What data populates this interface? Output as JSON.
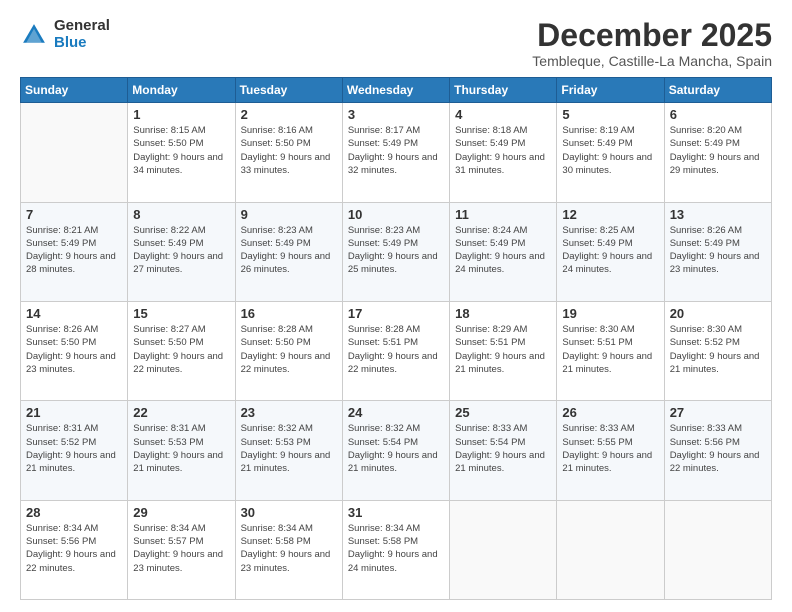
{
  "logo": {
    "general": "General",
    "blue": "Blue"
  },
  "title": "December 2025",
  "location": "Tembleque, Castille-La Mancha, Spain",
  "days_of_week": [
    "Sunday",
    "Monday",
    "Tuesday",
    "Wednesday",
    "Thursday",
    "Friday",
    "Saturday"
  ],
  "weeks": [
    [
      {
        "day": "",
        "sunrise": "",
        "sunset": "",
        "daylight": ""
      },
      {
        "day": "1",
        "sunrise": "Sunrise: 8:15 AM",
        "sunset": "Sunset: 5:50 PM",
        "daylight": "Daylight: 9 hours and 34 minutes."
      },
      {
        "day": "2",
        "sunrise": "Sunrise: 8:16 AM",
        "sunset": "Sunset: 5:50 PM",
        "daylight": "Daylight: 9 hours and 33 minutes."
      },
      {
        "day": "3",
        "sunrise": "Sunrise: 8:17 AM",
        "sunset": "Sunset: 5:49 PM",
        "daylight": "Daylight: 9 hours and 32 minutes."
      },
      {
        "day": "4",
        "sunrise": "Sunrise: 8:18 AM",
        "sunset": "Sunset: 5:49 PM",
        "daylight": "Daylight: 9 hours and 31 minutes."
      },
      {
        "day": "5",
        "sunrise": "Sunrise: 8:19 AM",
        "sunset": "Sunset: 5:49 PM",
        "daylight": "Daylight: 9 hours and 30 minutes."
      },
      {
        "day": "6",
        "sunrise": "Sunrise: 8:20 AM",
        "sunset": "Sunset: 5:49 PM",
        "daylight": "Daylight: 9 hours and 29 minutes."
      }
    ],
    [
      {
        "day": "7",
        "sunrise": "Sunrise: 8:21 AM",
        "sunset": "Sunset: 5:49 PM",
        "daylight": "Daylight: 9 hours and 28 minutes."
      },
      {
        "day": "8",
        "sunrise": "Sunrise: 8:22 AM",
        "sunset": "Sunset: 5:49 PM",
        "daylight": "Daylight: 9 hours and 27 minutes."
      },
      {
        "day": "9",
        "sunrise": "Sunrise: 8:23 AM",
        "sunset": "Sunset: 5:49 PM",
        "daylight": "Daylight: 9 hours and 26 minutes."
      },
      {
        "day": "10",
        "sunrise": "Sunrise: 8:23 AM",
        "sunset": "Sunset: 5:49 PM",
        "daylight": "Daylight: 9 hours and 25 minutes."
      },
      {
        "day": "11",
        "sunrise": "Sunrise: 8:24 AM",
        "sunset": "Sunset: 5:49 PM",
        "daylight": "Daylight: 9 hours and 24 minutes."
      },
      {
        "day": "12",
        "sunrise": "Sunrise: 8:25 AM",
        "sunset": "Sunset: 5:49 PM",
        "daylight": "Daylight: 9 hours and 24 minutes."
      },
      {
        "day": "13",
        "sunrise": "Sunrise: 8:26 AM",
        "sunset": "Sunset: 5:49 PM",
        "daylight": "Daylight: 9 hours and 23 minutes."
      }
    ],
    [
      {
        "day": "14",
        "sunrise": "Sunrise: 8:26 AM",
        "sunset": "Sunset: 5:50 PM",
        "daylight": "Daylight: 9 hours and 23 minutes."
      },
      {
        "day": "15",
        "sunrise": "Sunrise: 8:27 AM",
        "sunset": "Sunset: 5:50 PM",
        "daylight": "Daylight: 9 hours and 22 minutes."
      },
      {
        "day": "16",
        "sunrise": "Sunrise: 8:28 AM",
        "sunset": "Sunset: 5:50 PM",
        "daylight": "Daylight: 9 hours and 22 minutes."
      },
      {
        "day": "17",
        "sunrise": "Sunrise: 8:28 AM",
        "sunset": "Sunset: 5:51 PM",
        "daylight": "Daylight: 9 hours and 22 minutes."
      },
      {
        "day": "18",
        "sunrise": "Sunrise: 8:29 AM",
        "sunset": "Sunset: 5:51 PM",
        "daylight": "Daylight: 9 hours and 21 minutes."
      },
      {
        "day": "19",
        "sunrise": "Sunrise: 8:30 AM",
        "sunset": "Sunset: 5:51 PM",
        "daylight": "Daylight: 9 hours and 21 minutes."
      },
      {
        "day": "20",
        "sunrise": "Sunrise: 8:30 AM",
        "sunset": "Sunset: 5:52 PM",
        "daylight": "Daylight: 9 hours and 21 minutes."
      }
    ],
    [
      {
        "day": "21",
        "sunrise": "Sunrise: 8:31 AM",
        "sunset": "Sunset: 5:52 PM",
        "daylight": "Daylight: 9 hours and 21 minutes."
      },
      {
        "day": "22",
        "sunrise": "Sunrise: 8:31 AM",
        "sunset": "Sunset: 5:53 PM",
        "daylight": "Daylight: 9 hours and 21 minutes."
      },
      {
        "day": "23",
        "sunrise": "Sunrise: 8:32 AM",
        "sunset": "Sunset: 5:53 PM",
        "daylight": "Daylight: 9 hours and 21 minutes."
      },
      {
        "day": "24",
        "sunrise": "Sunrise: 8:32 AM",
        "sunset": "Sunset: 5:54 PM",
        "daylight": "Daylight: 9 hours and 21 minutes."
      },
      {
        "day": "25",
        "sunrise": "Sunrise: 8:33 AM",
        "sunset": "Sunset: 5:54 PM",
        "daylight": "Daylight: 9 hours and 21 minutes."
      },
      {
        "day": "26",
        "sunrise": "Sunrise: 8:33 AM",
        "sunset": "Sunset: 5:55 PM",
        "daylight": "Daylight: 9 hours and 21 minutes."
      },
      {
        "day": "27",
        "sunrise": "Sunrise: 8:33 AM",
        "sunset": "Sunset: 5:56 PM",
        "daylight": "Daylight: 9 hours and 22 minutes."
      }
    ],
    [
      {
        "day": "28",
        "sunrise": "Sunrise: 8:34 AM",
        "sunset": "Sunset: 5:56 PM",
        "daylight": "Daylight: 9 hours and 22 minutes."
      },
      {
        "day": "29",
        "sunrise": "Sunrise: 8:34 AM",
        "sunset": "Sunset: 5:57 PM",
        "daylight": "Daylight: 9 hours and 23 minutes."
      },
      {
        "day": "30",
        "sunrise": "Sunrise: 8:34 AM",
        "sunset": "Sunset: 5:58 PM",
        "daylight": "Daylight: 9 hours and 23 minutes."
      },
      {
        "day": "31",
        "sunrise": "Sunrise: 8:34 AM",
        "sunset": "Sunset: 5:58 PM",
        "daylight": "Daylight: 9 hours and 24 minutes."
      },
      {
        "day": "",
        "sunrise": "",
        "sunset": "",
        "daylight": ""
      },
      {
        "day": "",
        "sunrise": "",
        "sunset": "",
        "daylight": ""
      },
      {
        "day": "",
        "sunrise": "",
        "sunset": "",
        "daylight": ""
      }
    ]
  ]
}
